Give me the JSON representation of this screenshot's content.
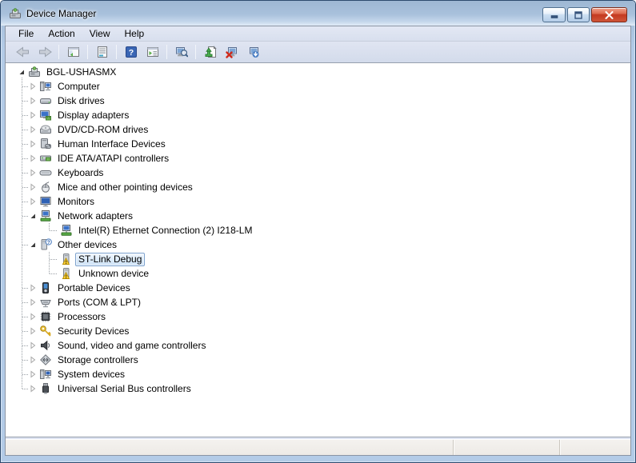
{
  "window": {
    "title": "Device Manager",
    "controls": {
      "minimize": "minimize",
      "maximize": "maximize",
      "close": "close"
    }
  },
  "menu": {
    "items": [
      "File",
      "Action",
      "View",
      "Help"
    ]
  },
  "toolbar": {
    "items": [
      {
        "type": "button",
        "name": "back",
        "icon": "arrow-left-icon",
        "disabled": true
      },
      {
        "type": "button",
        "name": "forward",
        "icon": "arrow-right-icon",
        "disabled": true
      },
      {
        "type": "separator"
      },
      {
        "type": "button",
        "name": "show-console-tree",
        "icon": "console-tree-icon"
      },
      {
        "type": "separator"
      },
      {
        "type": "button",
        "name": "properties",
        "icon": "properties-icon"
      },
      {
        "type": "separator"
      },
      {
        "type": "button",
        "name": "help",
        "icon": "help-icon"
      },
      {
        "type": "button",
        "name": "show-action-pane",
        "icon": "action-pane-icon"
      },
      {
        "type": "separator"
      },
      {
        "type": "button",
        "name": "scan-hardware-changes",
        "icon": "scan-computer-icon"
      },
      {
        "type": "separator"
      },
      {
        "type": "button",
        "name": "update-driver",
        "icon": "update-driver-icon"
      },
      {
        "type": "button",
        "name": "uninstall-device",
        "icon": "uninstall-icon"
      },
      {
        "type": "button",
        "name": "disable-device",
        "icon": "disable-icon"
      }
    ]
  },
  "tree": {
    "items": [
      {
        "label": "BGL-USHASMX",
        "level": 0,
        "expander": "expanded",
        "icon": "computer-mgmt"
      },
      {
        "label": "Computer",
        "level": 1,
        "expander": "collapsed",
        "icon": "computer"
      },
      {
        "label": "Disk drives",
        "level": 1,
        "expander": "collapsed",
        "icon": "disk-drive"
      },
      {
        "label": "Display adapters",
        "level": 1,
        "expander": "collapsed",
        "icon": "display-adapter"
      },
      {
        "label": "DVD/CD-ROM drives",
        "level": 1,
        "expander": "collapsed",
        "icon": "dvd-drive"
      },
      {
        "label": "Human Interface Devices",
        "level": 1,
        "expander": "collapsed",
        "icon": "hid-device"
      },
      {
        "label": "IDE ATA/ATAPI controllers",
        "level": 1,
        "expander": "collapsed",
        "icon": "ide-controller"
      },
      {
        "label": "Keyboards",
        "level": 1,
        "expander": "collapsed",
        "icon": "keyboard"
      },
      {
        "label": "Mice and other pointing devices",
        "level": 1,
        "expander": "collapsed",
        "icon": "mouse"
      },
      {
        "label": "Monitors",
        "level": 1,
        "expander": "collapsed",
        "icon": "monitor"
      },
      {
        "label": "Network adapters",
        "level": 1,
        "expander": "expanded",
        "icon": "network-adapter"
      },
      {
        "label": "Intel(R) Ethernet Connection (2) I218-LM",
        "level": 2,
        "expander": "none",
        "icon": "network-adapter"
      },
      {
        "label": "Other devices",
        "level": 1,
        "expander": "expanded",
        "icon": "unknown-question-device"
      },
      {
        "label": "ST-Link Debug",
        "level": 2,
        "expander": "none",
        "icon": "warning-device",
        "selected": true
      },
      {
        "label": "Unknown device",
        "level": 2,
        "expander": "none",
        "icon": "warning-device"
      },
      {
        "label": "Portable Devices",
        "level": 1,
        "expander": "collapsed",
        "icon": "portable-device"
      },
      {
        "label": "Ports (COM & LPT)",
        "level": 1,
        "expander": "collapsed",
        "icon": "port-connector"
      },
      {
        "label": "Processors",
        "level": 1,
        "expander": "collapsed",
        "icon": "processor-chip"
      },
      {
        "label": "Security Devices",
        "level": 1,
        "expander": "collapsed",
        "icon": "security-key"
      },
      {
        "label": "Sound, video and game controllers",
        "level": 1,
        "expander": "collapsed",
        "icon": "speaker"
      },
      {
        "label": "Storage controllers",
        "level": 1,
        "expander": "collapsed",
        "icon": "storage-controller"
      },
      {
        "label": "System devices",
        "level": 1,
        "expander": "collapsed",
        "icon": "system-device"
      },
      {
        "label": "Universal Serial Bus controllers",
        "level": 1,
        "expander": "collapsed",
        "icon": "usb-connector"
      }
    ]
  },
  "statusbar": {
    "sections": [
      "",
      "",
      ""
    ]
  },
  "colors": {
    "titlebar_top": "#9db7d3",
    "selection_border": "#7da2ce",
    "selection_fill": "#dcebfa",
    "warning_yellow": "#fdd23a",
    "close_button_red": "#c43a20",
    "tree_background": "#ffffff",
    "chrome_background": "#d8dfee"
  }
}
